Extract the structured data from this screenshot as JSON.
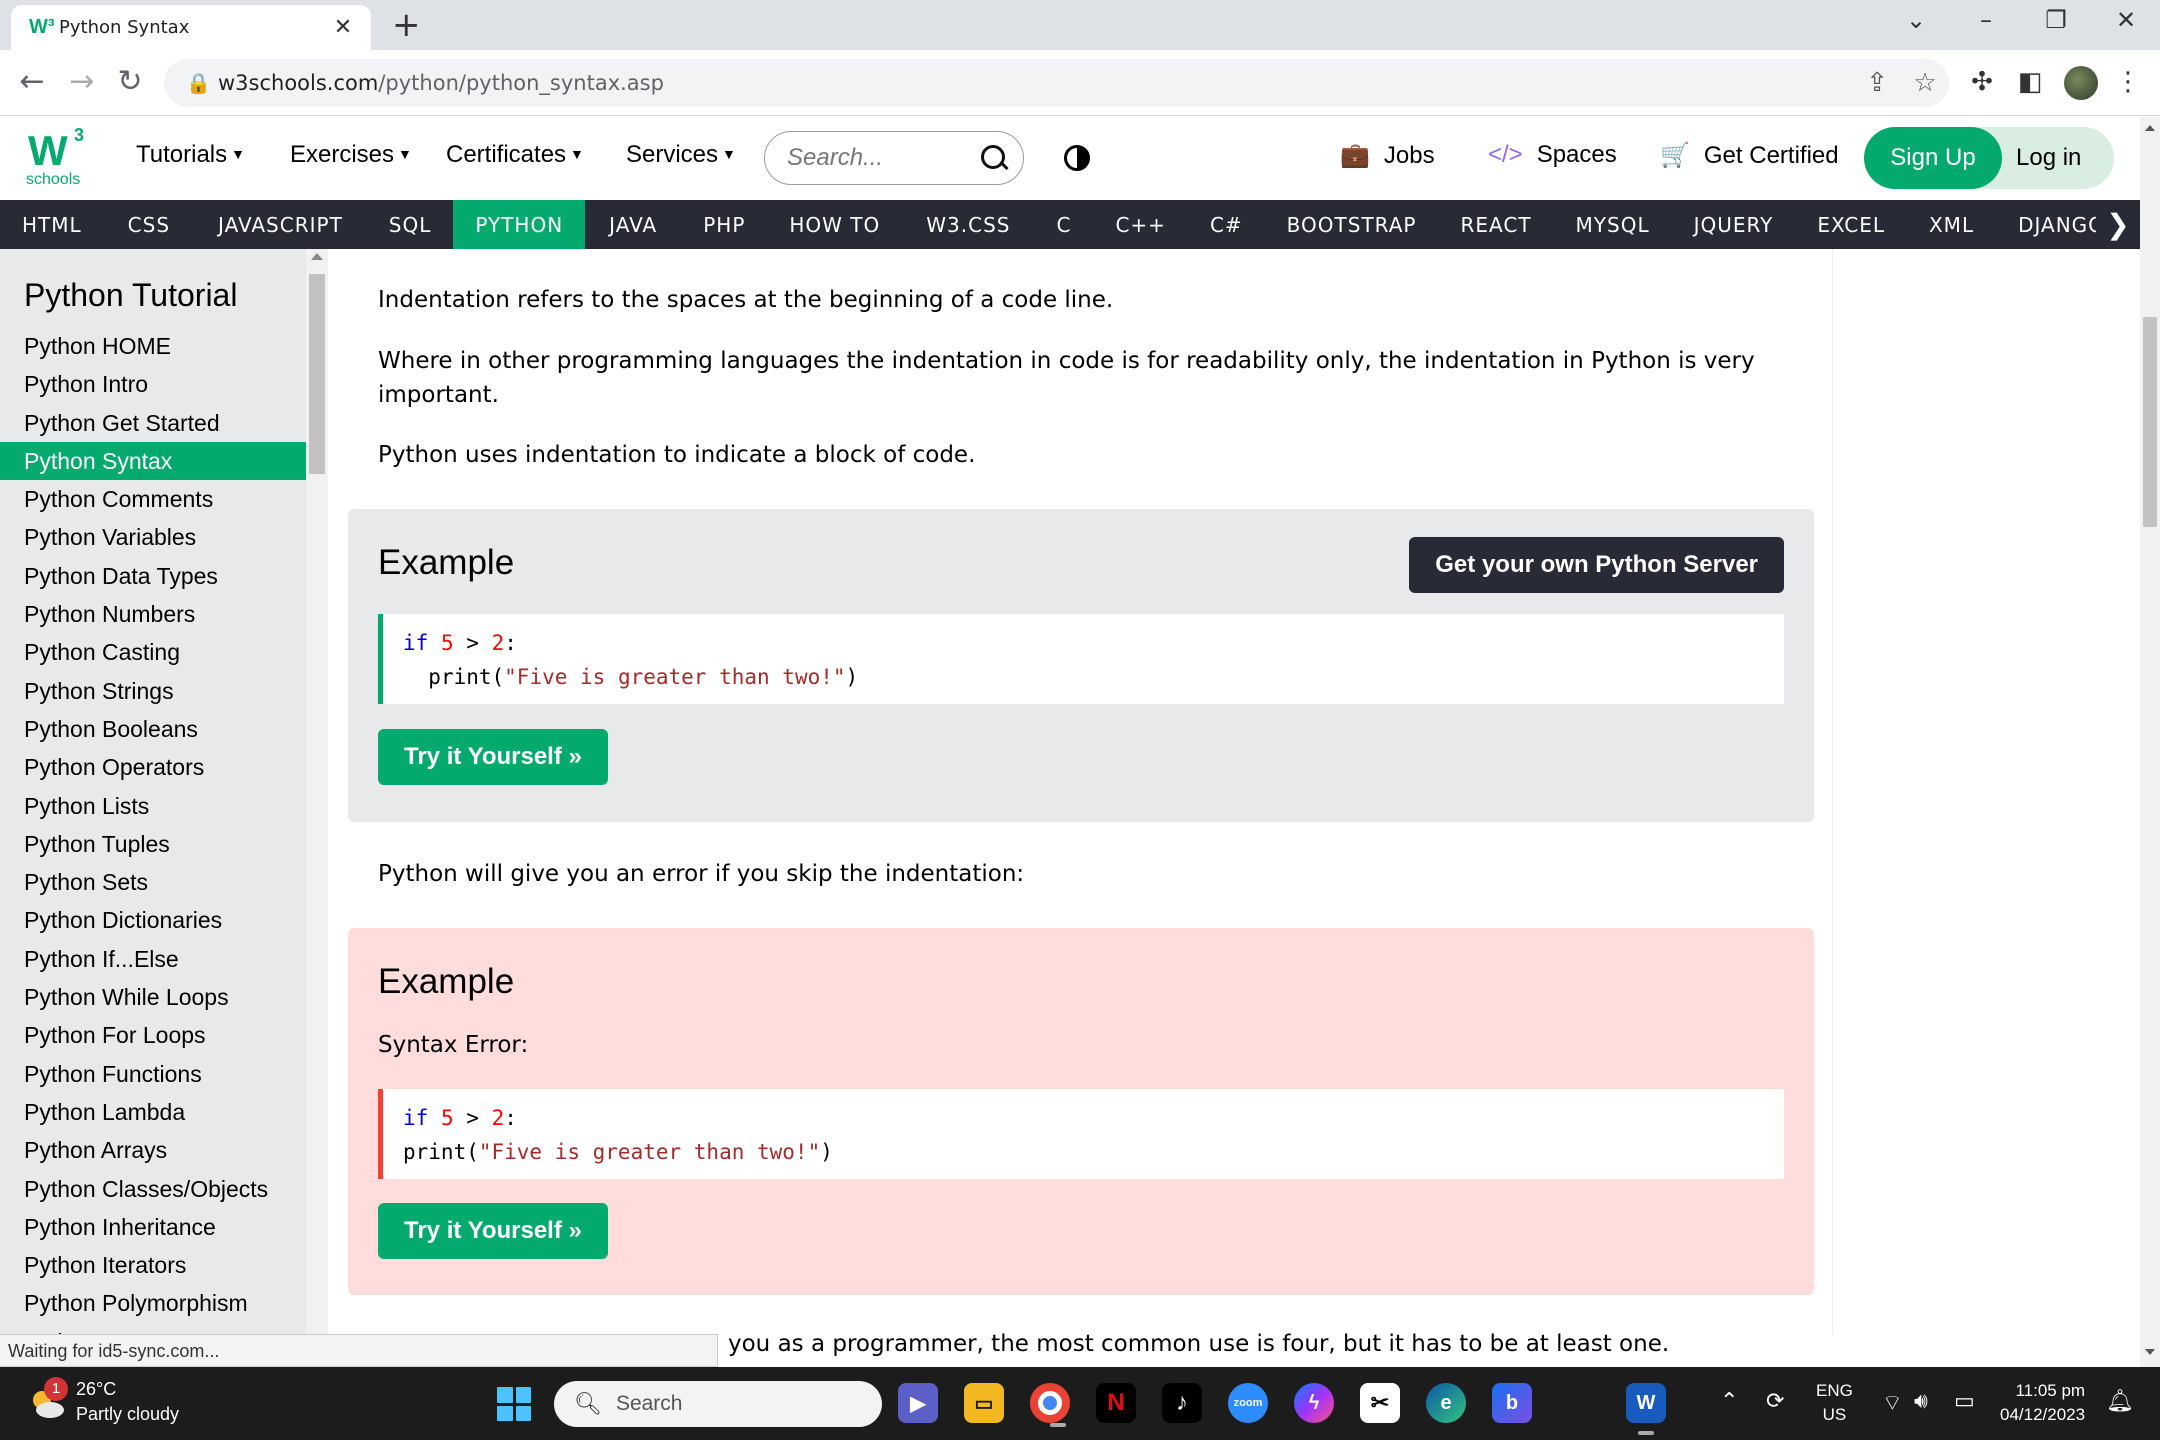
{
  "browser": {
    "tab_title": "Python Syntax",
    "tab_favicon": "W³",
    "url_host": "w3schools.com",
    "url_path": "/python/python_syntax.asp",
    "status_text": "Waiting for id5-sync.com..."
  },
  "w3nav": {
    "logo_w": "W",
    "logo_3": "3",
    "logo_schools": "schools",
    "menus": [
      "Tutorials",
      "Exercises",
      "Certificates",
      "Services"
    ],
    "search_placeholder": "Search...",
    "jobs": "Jobs",
    "spaces": "Spaces",
    "get_certified": "Get Certified",
    "sign_up": "Sign Up",
    "log_in": "Log in"
  },
  "subjects": [
    "HTML",
    "CSS",
    "JAVASCRIPT",
    "SQL",
    "PYTHON",
    "JAVA",
    "PHP",
    "HOW TO",
    "W3.CSS",
    "C",
    "C++",
    "C#",
    "BOOTSTRAP",
    "REACT",
    "MYSQL",
    "JQUERY",
    "EXCEL",
    "XML",
    "DJANGO"
  ],
  "active_subject": "PYTHON",
  "sidebar": {
    "title": "Python Tutorial",
    "active": "Python Syntax",
    "items": [
      "Python HOME",
      "Python Intro",
      "Python Get Started",
      "Python Syntax",
      "Python Comments",
      "Python Variables",
      "Python Data Types",
      "Python Numbers",
      "Python Casting",
      "Python Strings",
      "Python Booleans",
      "Python Operators",
      "Python Lists",
      "Python Tuples",
      "Python Sets",
      "Python Dictionaries",
      "Python If...Else",
      "Python While Loops",
      "Python For Loops",
      "Python Functions",
      "Python Lambda",
      "Python Arrays",
      "Python Classes/Objects",
      "Python Inheritance",
      "Python Iterators",
      "Python Polymorphism",
      "Python Scope"
    ]
  },
  "content": {
    "p1": "Indentation refers to the spaces at the beginning of a code line.",
    "p2": "Where in other programming languages the indentation in code is for readability only, the indentation in Python is very important.",
    "p3": "Python uses indentation to indicate a block of code.",
    "example1": {
      "title": "Example",
      "server_button": "Get your own Python Server",
      "code_line1": {
        "kw": "if",
        "a": "5",
        "op": ">",
        "b": "2",
        "colon": ":"
      },
      "code_line2": {
        "indent": "  ",
        "fn": "print(",
        "str": "\"Five is greater than two!\"",
        "close": ")"
      },
      "try_button": "Try it Yourself »"
    },
    "p4": "Python will give you an error if you skip the indentation:",
    "example2": {
      "title": "Example",
      "label": "Syntax Error:",
      "code_line1": {
        "kw": "if",
        "a": "5",
        "op": ">",
        "b": "2",
        "colon": ":"
      },
      "code_line2": {
        "indent": "",
        "fn": "print(",
        "str": "\"Five is greater than two!\"",
        "close": ")"
      },
      "try_button": "Try it Yourself »"
    },
    "p5_partial": "you as a programmer, the most common use is four, but it has to be at least one."
  },
  "taskbar": {
    "weather_badge": "1",
    "temp": "26°C",
    "condition": "Partly cloudy",
    "search": "Search",
    "lang_top": "ENG",
    "lang_bottom": "US",
    "time": "11:05 pm",
    "date": "04/12/2023"
  },
  "colors": {
    "w3_green": "#04aa6d",
    "subnav_dark": "#282a35",
    "sidebar_bg": "#e7e9eb",
    "error_bg": "#ffdddd",
    "error_border": "#f44336"
  }
}
